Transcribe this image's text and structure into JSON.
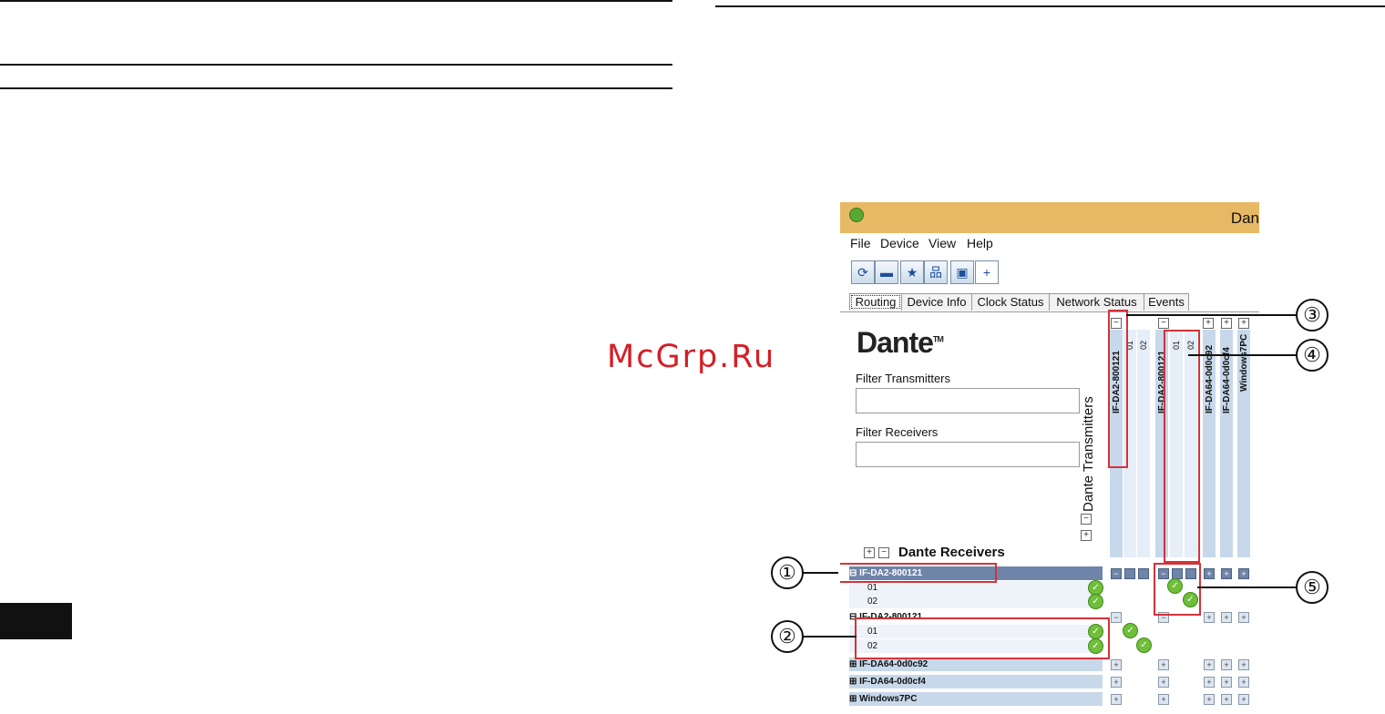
{
  "watermark": "McGrp.Ru",
  "window": {
    "title": "Dan",
    "menu": [
      "File",
      "Device",
      "View",
      "Help"
    ],
    "toolbar_icons": [
      "refresh-icon",
      "folder-icon",
      "star-icon",
      "network-icon",
      "monitor-icon",
      "plus-icon"
    ],
    "tabs": [
      "Routing",
      "Device Info",
      "Clock Status",
      "Network Status",
      "Events"
    ],
    "active_tab": "Routing"
  },
  "routing": {
    "logo": "Dante",
    "logo_tm": "TM",
    "filter_transmitters_label": "Filter Transmitters",
    "filter_receivers_label": "Filter Receivers",
    "filter_transmitters_value": "",
    "filter_receivers_value": "",
    "dante_transmitters": "Dante Transmitters",
    "dante_receivers": "Dante Receivers",
    "transmitters": [
      {
        "name": "IF-DA2-800121",
        "channels": [
          "01",
          "02"
        ]
      },
      {
        "name": "IF-DA2-800121",
        "channels": [
          "01",
          "02"
        ]
      },
      {
        "name": "IF-DA64-0d0c92"
      },
      {
        "name": "IF-DA64-0d0cf4"
      },
      {
        "name": "Windows7PC"
      }
    ],
    "receivers": [
      {
        "name": "IF-DA2-800121",
        "channels": [
          "01",
          "02"
        ]
      },
      {
        "name": "IF-DA2-800121",
        "channels": [
          "01",
          "02"
        ]
      },
      {
        "name": "IF-DA64-0d0c92"
      },
      {
        "name": "IF-DA64-0d0cf4"
      },
      {
        "name": "Windows7PC"
      }
    ]
  },
  "callouts": [
    "①",
    "②",
    "③",
    "④",
    "⑤"
  ],
  "colors": {
    "titlebar": "#e8b965",
    "selected_row": "#6e84a8",
    "highlight": "#d4323a",
    "watermark": "#d41f26"
  }
}
